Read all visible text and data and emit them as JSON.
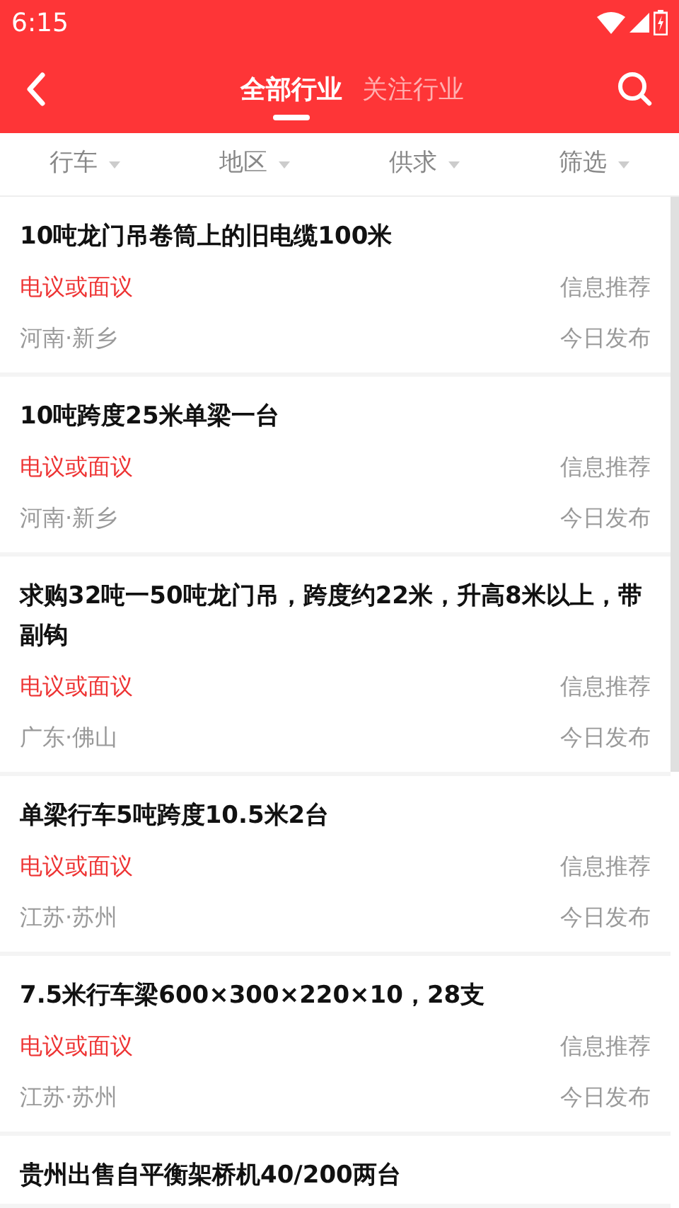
{
  "status_bar": {
    "time": "6:15"
  },
  "header": {
    "tabs": [
      {
        "label": "全部行业",
        "selected": true
      },
      {
        "label": "关注行业",
        "selected": false
      }
    ]
  },
  "filters": [
    {
      "label": "行车"
    },
    {
      "label": "地区"
    },
    {
      "label": "供求"
    },
    {
      "label": "筛选"
    }
  ],
  "listings": [
    {
      "title": "10吨龙门吊卷筒上的旧电缆100米",
      "price": "电议或面议",
      "source": "信息推荐",
      "location": "河南·新乡",
      "posted": "今日发布"
    },
    {
      "title": "10吨跨度25米单梁一台",
      "price": "电议或面议",
      "source": "信息推荐",
      "location": "河南·新乡",
      "posted": "今日发布"
    },
    {
      "title": "求购32吨一50吨龙门吊，跨度约22米，升高8米以上，带副钩",
      "price": "电议或面议",
      "source": "信息推荐",
      "location": "广东·佛山",
      "posted": "今日发布"
    },
    {
      "title": "单梁行车5吨跨度10.5米2台",
      "price": "电议或面议",
      "source": "信息推荐",
      "location": "江苏·苏州",
      "posted": "今日发布"
    },
    {
      "title": "7.5米行车梁600×300×220×10，28支",
      "price": "电议或面议",
      "source": "信息推荐",
      "location": "江苏·苏州",
      "posted": "今日发布"
    },
    {
      "title": "贵州出售自平衡架桥机40/200两台"
    }
  ]
}
